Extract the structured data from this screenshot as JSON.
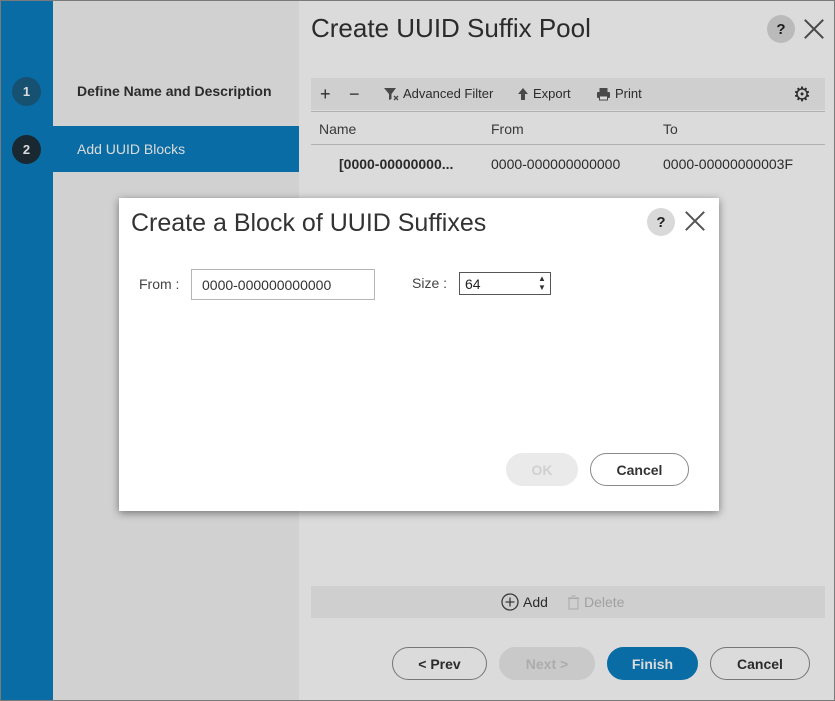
{
  "wizard": {
    "steps": [
      {
        "number": "1",
        "label": "Define Name and Description"
      },
      {
        "number": "2",
        "label": "Add UUID Blocks"
      }
    ]
  },
  "main": {
    "title": "Create UUID Suffix Pool",
    "help": "?",
    "toolbar": {
      "add": "+",
      "remove": "−",
      "advanced_filter": "Advanced Filter",
      "export": "Export",
      "print": "Print"
    },
    "table": {
      "columns": [
        "Name",
        "From",
        "To"
      ],
      "rows": [
        {
          "name": "[0000-00000000...",
          "from": "0000-000000000000",
          "to": "0000-00000000003F"
        }
      ]
    },
    "grid_footer": {
      "add": "Add",
      "delete": "Delete"
    },
    "buttons": {
      "prev": "< Prev",
      "next": "Next >",
      "finish": "Finish",
      "cancel": "Cancel"
    }
  },
  "modal": {
    "title": "Create a Block of UUID Suffixes",
    "help": "?",
    "from_label": "From :",
    "from_value": "0000-000000000000",
    "size_label": "Size :",
    "size_value": "64",
    "ok": "OK",
    "cancel": "Cancel"
  },
  "colors": {
    "accent": "#0b7ec0",
    "step_active_num": "#1e2f3a",
    "step_inactive_num": "#1b5f85"
  }
}
